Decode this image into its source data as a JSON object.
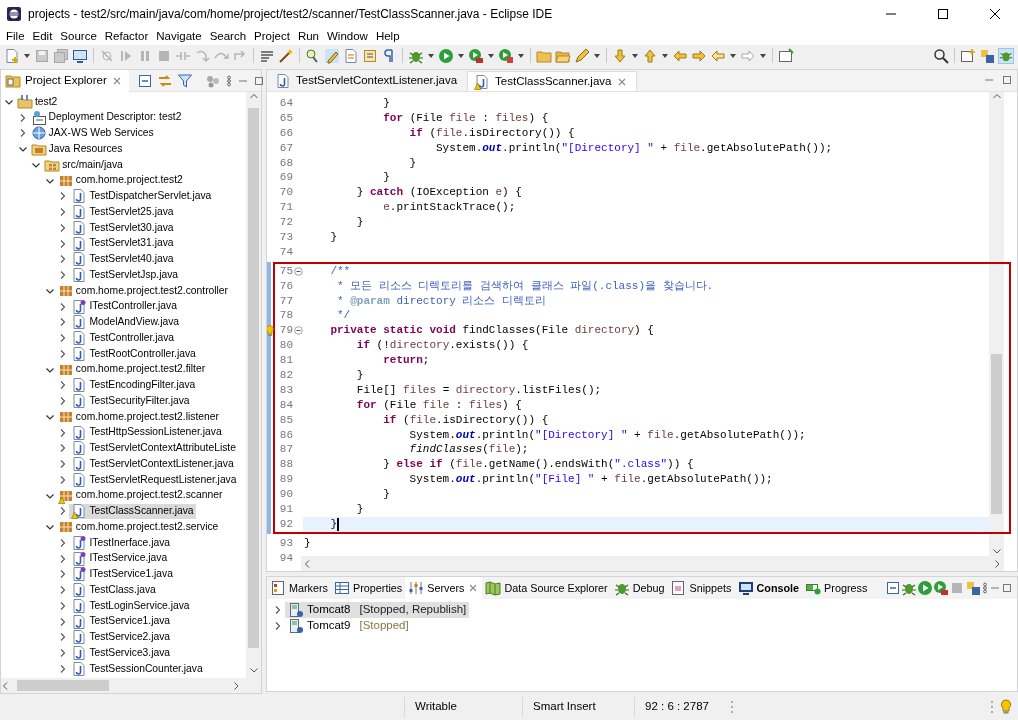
{
  "window": {
    "title": "projects - test2/src/main/java/com/home/project/test2/scanner/TestClassScanner.java - Eclipse IDE"
  },
  "menu": [
    "File",
    "Edit",
    "Source",
    "Refactor",
    "Navigate",
    "Search",
    "Project",
    "Run",
    "Window",
    "Help"
  ],
  "project_explorer": {
    "title": "Project Explorer",
    "tree": [
      {
        "label": "test2",
        "kind": "project",
        "expanded": true,
        "selected": false,
        "warning": false,
        "children": [
          {
            "label": "Deployment Descriptor: test2",
            "kind": "descriptor",
            "expanded": false,
            "selected": false,
            "warning": false
          },
          {
            "label": "JAX-WS Web Services",
            "kind": "webservices",
            "expanded": false,
            "selected": false,
            "warning": false
          },
          {
            "label": "Java Resources",
            "kind": "resources",
            "expanded": true,
            "selected": false,
            "warning": false,
            "children": [
              {
                "label": "src/main/java",
                "kind": "srcfolder",
                "expanded": true,
                "selected": false,
                "warning": false,
                "children": [
                  {
                    "label": "com.home.project.test2",
                    "kind": "package",
                    "expanded": true,
                    "selected": false,
                    "warning": false,
                    "children": [
                      {
                        "label": "TestDispatcherServlet.java",
                        "kind": "class",
                        "expanded": false,
                        "selected": false,
                        "warning": false
                      },
                      {
                        "label": "TestServlet25.java",
                        "kind": "class",
                        "expanded": false,
                        "selected": false,
                        "warning": false
                      },
                      {
                        "label": "TestServlet30.java",
                        "kind": "class",
                        "expanded": false,
                        "selected": false,
                        "warning": false
                      },
                      {
                        "label": "TestServlet31.java",
                        "kind": "class",
                        "expanded": false,
                        "selected": false,
                        "warning": false
                      },
                      {
                        "label": "TestServlet40.java",
                        "kind": "class",
                        "expanded": false,
                        "selected": false,
                        "warning": false
                      },
                      {
                        "label": "TestServletJsp.java",
                        "kind": "class",
                        "expanded": false,
                        "selected": false,
                        "warning": false
                      }
                    ]
                  },
                  {
                    "label": "com.home.project.test2.controller",
                    "kind": "package",
                    "expanded": true,
                    "selected": false,
                    "warning": false,
                    "children": [
                      {
                        "label": "ITestController.java",
                        "kind": "interface",
                        "expanded": false,
                        "selected": false,
                        "warning": false
                      },
                      {
                        "label": "ModelAndView.java",
                        "kind": "class",
                        "expanded": false,
                        "selected": false,
                        "warning": false
                      },
                      {
                        "label": "TestController.java",
                        "kind": "class",
                        "expanded": false,
                        "selected": false,
                        "warning": false
                      },
                      {
                        "label": "TestRootController.java",
                        "kind": "class",
                        "expanded": false,
                        "selected": false,
                        "warning": false
                      }
                    ]
                  },
                  {
                    "label": "com.home.project.test2.filter",
                    "kind": "package",
                    "expanded": true,
                    "selected": false,
                    "warning": false,
                    "children": [
                      {
                        "label": "TestEncodingFilter.java",
                        "kind": "class",
                        "expanded": false,
                        "selected": false,
                        "warning": false
                      },
                      {
                        "label": "TestSecurityFilter.java",
                        "kind": "class",
                        "expanded": false,
                        "selected": false,
                        "warning": false
                      }
                    ]
                  },
                  {
                    "label": "com.home.project.test2.listener",
                    "kind": "package",
                    "expanded": true,
                    "selected": false,
                    "warning": false,
                    "children": [
                      {
                        "label": "TestHttpSessionListener.java",
                        "kind": "class",
                        "expanded": false,
                        "selected": false,
                        "warning": false
                      },
                      {
                        "label": "TestServletContextAttributeListe",
                        "kind": "class",
                        "expanded": false,
                        "selected": false,
                        "warning": false
                      },
                      {
                        "label": "TestServletContextListener.java",
                        "kind": "class",
                        "expanded": false,
                        "selected": false,
                        "warning": false
                      },
                      {
                        "label": "TestServletRequestListener.java",
                        "kind": "class",
                        "expanded": false,
                        "selected": false,
                        "warning": false
                      }
                    ]
                  },
                  {
                    "label": "com.home.project.test2.scanner",
                    "kind": "package",
                    "expanded": true,
                    "selected": false,
                    "warning": true,
                    "children": [
                      {
                        "label": "TestClassScanner.java",
                        "kind": "class",
                        "expanded": false,
                        "selected": true,
                        "warning": true
                      }
                    ]
                  },
                  {
                    "label": "com.home.project.test2.service",
                    "kind": "package",
                    "expanded": true,
                    "selected": false,
                    "warning": false,
                    "children": [
                      {
                        "label": "ITestInerface.java",
                        "kind": "interface",
                        "expanded": false,
                        "selected": false,
                        "warning": false
                      },
                      {
                        "label": "ITestService.java",
                        "kind": "interface",
                        "expanded": false,
                        "selected": false,
                        "warning": false
                      },
                      {
                        "label": "ITestService1.java",
                        "kind": "interface",
                        "expanded": false,
                        "selected": false,
                        "warning": false
                      },
                      {
                        "label": "TestClass.java",
                        "kind": "class",
                        "expanded": false,
                        "selected": false,
                        "warning": false
                      },
                      {
                        "label": "TestLoginService.java",
                        "kind": "class",
                        "expanded": false,
                        "selected": false,
                        "warning": false
                      },
                      {
                        "label": "TestService1.java",
                        "kind": "class",
                        "expanded": false,
                        "selected": false,
                        "warning": false
                      },
                      {
                        "label": "TestService2.java",
                        "kind": "class",
                        "expanded": false,
                        "selected": false,
                        "warning": false
                      },
                      {
                        "label": "TestService3.java",
                        "kind": "class",
                        "expanded": false,
                        "selected": false,
                        "warning": false
                      },
                      {
                        "label": "TestSessionCounter.java",
                        "kind": "class",
                        "expanded": false,
                        "selected": false,
                        "warning": false
                      }
                    ]
                  }
                ]
              }
            ]
          }
        ]
      }
    ]
  },
  "editor": {
    "tabs": [
      {
        "label": "TestServletContextListener.java",
        "selected": false,
        "warning": false
      },
      {
        "label": "TestClassScanner.java",
        "selected": true,
        "warning": true
      }
    ],
    "blocks": [
      {
        "highlighted": false,
        "changed": false,
        "lines": [
          {
            "number": "64",
            "current": false,
            "fold": false,
            "warning": false,
            "tokens": [
              {
                "kind": "plain",
                "text": "            }"
              }
            ]
          },
          {
            "number": "65",
            "current": false,
            "fold": false,
            "warning": false,
            "tokens": [
              {
                "kind": "keyword",
                "text": "            for"
              },
              {
                "kind": "plain",
                "text": " (File "
              },
              {
                "kind": "variable",
                "text": "file"
              },
              {
                "kind": "plain",
                "text": " : "
              },
              {
                "kind": "variable",
                "text": "files"
              },
              {
                "kind": "plain",
                "text": ") {"
              }
            ]
          },
          {
            "number": "66",
            "current": false,
            "fold": false,
            "warning": false,
            "tokens": [
              {
                "kind": "keyword",
                "text": "                if"
              },
              {
                "kind": "plain",
                "text": " ("
              },
              {
                "kind": "variable",
                "text": "file"
              },
              {
                "kind": "plain",
                "text": ".isDirectory()) {"
              }
            ]
          },
          {
            "number": "67",
            "current": false,
            "fold": false,
            "warning": false,
            "tokens": [
              {
                "kind": "plain",
                "text": "                    System."
              },
              {
                "kind": "field",
                "text": "out"
              },
              {
                "kind": "plain",
                "text": ".println("
              },
              {
                "kind": "string",
                "text": "\"[Directory] \""
              },
              {
                "kind": "plain",
                "text": " + "
              },
              {
                "kind": "variable",
                "text": "file"
              },
              {
                "kind": "plain",
                "text": ".getAbsolutePath());"
              }
            ]
          },
          {
            "number": "68",
            "current": false,
            "fold": false,
            "warning": false,
            "tokens": [
              {
                "kind": "plain",
                "text": "                }"
              }
            ]
          },
          {
            "number": "69",
            "current": false,
            "fold": false,
            "warning": false,
            "tokens": [
              {
                "kind": "plain",
                "text": "            }"
              }
            ]
          },
          {
            "number": "70",
            "current": false,
            "fold": false,
            "warning": false,
            "tokens": [
              {
                "kind": "plain",
                "text": "        } "
              },
              {
                "kind": "keyword",
                "text": "catch"
              },
              {
                "kind": "plain",
                "text": " (IOException "
              },
              {
                "kind": "variable",
                "text": "e"
              },
              {
                "kind": "plain",
                "text": ") {"
              }
            ]
          },
          {
            "number": "71",
            "current": false,
            "fold": false,
            "warning": false,
            "tokens": [
              {
                "kind": "variable",
                "text": "            e"
              },
              {
                "kind": "plain",
                "text": ".printStackTrace();"
              }
            ]
          },
          {
            "number": "72",
            "current": false,
            "fold": false,
            "warning": false,
            "tokens": [
              {
                "kind": "plain",
                "text": "        }"
              }
            ]
          },
          {
            "number": "73",
            "current": false,
            "fold": false,
            "warning": false,
            "tokens": [
              {
                "kind": "plain",
                "text": "    }"
              }
            ]
          },
          {
            "number": "74",
            "current": false,
            "fold": false,
            "warning": false
          }
        ]
      },
      {
        "highlighted": true,
        "changed": true,
        "lines": [
          {
            "number": "75",
            "current": false,
            "fold": true,
            "warning": false,
            "tokens": [
              {
                "kind": "comment",
                "text": "    /**"
              }
            ]
          },
          {
            "number": "76",
            "current": false,
            "fold": false,
            "warning": false,
            "tokens": [
              {
                "kind": "comment",
                "text": "     * 모든 리소스 디렉토리를 검색하여 클래스 파일(.class)을 찾습니다."
              }
            ]
          },
          {
            "number": "77",
            "current": false,
            "fold": false,
            "warning": false,
            "tokens": [
              {
                "kind": "comment",
                "text": "     * "
              },
              {
                "kind": "tag",
                "text": "@param"
              },
              {
                "kind": "comment",
                "text": " directory 리소스 디렉토리"
              }
            ]
          },
          {
            "number": "78",
            "current": false,
            "fold": false,
            "warning": false,
            "tokens": [
              {
                "kind": "comment",
                "text": "     */"
              }
            ]
          },
          {
            "number": "79",
            "current": false,
            "fold": true,
            "warning": true,
            "tokens": [
              {
                "kind": "keyword",
                "text": "    private "
              },
              {
                "kind": "keyword",
                "text": "static "
              },
              {
                "kind": "keyword",
                "text": "void"
              },
              {
                "kind": "plain",
                "text": " findClasses(File "
              },
              {
                "kind": "variable",
                "text": "directory"
              },
              {
                "kind": "plain",
                "text": ") {"
              }
            ]
          },
          {
            "number": "80",
            "current": false,
            "fold": false,
            "warning": false,
            "tokens": [
              {
                "kind": "keyword",
                "text": "        if"
              },
              {
                "kind": "plain",
                "text": " (!"
              },
              {
                "kind": "variable",
                "text": "directory"
              },
              {
                "kind": "plain",
                "text": ".exists()) {"
              }
            ]
          },
          {
            "number": "81",
            "current": false,
            "fold": false,
            "warning": false,
            "tokens": [
              {
                "kind": "keyword",
                "text": "            return"
              },
              {
                "kind": "plain",
                "text": ";"
              }
            ]
          },
          {
            "number": "82",
            "current": false,
            "fold": false,
            "warning": false,
            "tokens": [
              {
                "kind": "plain",
                "text": "        }"
              }
            ]
          },
          {
            "number": "83",
            "current": false,
            "fold": false,
            "warning": false,
            "tokens": [
              {
                "kind": "plain",
                "text": "        File[] "
              },
              {
                "kind": "variable",
                "text": "files"
              },
              {
                "kind": "plain",
                "text": " = "
              },
              {
                "kind": "variable",
                "text": "directory"
              },
              {
                "kind": "plain",
                "text": ".listFiles();"
              }
            ]
          },
          {
            "number": "84",
            "current": false,
            "fold": false,
            "warning": false,
            "tokens": [
              {
                "kind": "keyword",
                "text": "        for"
              },
              {
                "kind": "plain",
                "text": " (File "
              },
              {
                "kind": "variable",
                "text": "file"
              },
              {
                "kind": "plain",
                "text": " : "
              },
              {
                "kind": "variable",
                "text": "files"
              },
              {
                "kind": "plain",
                "text": ") {"
              }
            ]
          },
          {
            "number": "85",
            "current": false,
            "fold": false,
            "warning": false,
            "tokens": [
              {
                "kind": "keyword",
                "text": "            if"
              },
              {
                "kind": "plain",
                "text": " ("
              },
              {
                "kind": "variable",
                "text": "file"
              },
              {
                "kind": "plain",
                "text": ".isDirectory()) {"
              }
            ]
          },
          {
            "number": "86",
            "current": false,
            "fold": false,
            "warning": false,
            "tokens": [
              {
                "kind": "plain",
                "text": "                System."
              },
              {
                "kind": "field",
                "text": "out"
              },
              {
                "kind": "plain",
                "text": ".println("
              },
              {
                "kind": "string",
                "text": "\"[Directory] \""
              },
              {
                "kind": "plain",
                "text": " + "
              },
              {
                "kind": "variable",
                "text": "file"
              },
              {
                "kind": "plain",
                "text": ".getAbsolutePath());"
              }
            ]
          },
          {
            "number": "87",
            "current": false,
            "fold": false,
            "warning": false,
            "tokens": [
              {
                "kind": "static",
                "text": "                findClasses"
              },
              {
                "kind": "plain",
                "text": "("
              },
              {
                "kind": "variable",
                "text": "file"
              },
              {
                "kind": "plain",
                "text": ");"
              }
            ]
          },
          {
            "number": "88",
            "current": false,
            "fold": false,
            "warning": false,
            "tokens": [
              {
                "kind": "plain",
                "text": "            } "
              },
              {
                "kind": "keyword",
                "text": "else "
              },
              {
                "kind": "keyword",
                "text": "if"
              },
              {
                "kind": "plain",
                "text": " ("
              },
              {
                "kind": "variable",
                "text": "file"
              },
              {
                "kind": "plain",
                "text": ".getName().endsWith("
              },
              {
                "kind": "string",
                "text": "\".class\""
              },
              {
                "kind": "plain",
                "text": ")) {"
              }
            ]
          },
          {
            "number": "89",
            "current": false,
            "fold": false,
            "warning": false,
            "tokens": [
              {
                "kind": "plain",
                "text": "                System."
              },
              {
                "kind": "field",
                "text": "out"
              },
              {
                "kind": "plain",
                "text": ".println("
              },
              {
                "kind": "string",
                "text": "\"[File] \""
              },
              {
                "kind": "plain",
                "text": " + "
              },
              {
                "kind": "variable",
                "text": "file"
              },
              {
                "kind": "plain",
                "text": ".getAbsolutePath());"
              }
            ]
          },
          {
            "number": "90",
            "current": false,
            "fold": false,
            "warning": false,
            "tokens": [
              {
                "kind": "plain",
                "text": "            }"
              }
            ]
          },
          {
            "number": "91",
            "current": false,
            "fold": false,
            "warning": false,
            "tokens": [
              {
                "kind": "plain",
                "text": "        }"
              }
            ]
          },
          {
            "number": "92",
            "current": true,
            "fold": false,
            "warning": false,
            "tokens": [
              {
                "kind": "plain",
                "text": "    }"
              }
            ]
          }
        ]
      },
      {
        "highlighted": false,
        "changed": false,
        "lines": [
          {
            "number": "93",
            "current": false,
            "fold": false,
            "warning": false,
            "tokens": [
              {
                "kind": "plain",
                "text": "}"
              }
            ]
          },
          {
            "number": "94",
            "current": false,
            "fold": false,
            "warning": false
          }
        ]
      }
    ]
  },
  "bottom_panel": {
    "tabs": [
      {
        "label": "Markers",
        "kind": "markers",
        "selected": false,
        "attention": false
      },
      {
        "label": "Properties",
        "kind": "properties",
        "selected": false,
        "attention": false
      },
      {
        "label": "Servers",
        "kind": "servers",
        "selected": true,
        "attention": false
      },
      {
        "label": "Data Source Explorer",
        "kind": "datasource",
        "selected": false,
        "attention": false
      },
      {
        "label": "Debug",
        "kind": "debug",
        "selected": false,
        "attention": false
      },
      {
        "label": "Snippets",
        "kind": "snippets",
        "selected": false,
        "attention": false
      },
      {
        "label": "Console",
        "kind": "console",
        "selected": false,
        "attention": true
      },
      {
        "label": "Progress",
        "kind": "progress",
        "selected": false,
        "attention": false
      }
    ],
    "servers": [
      {
        "name": "Tomcat8",
        "status": "[Stopped, Republish]",
        "selected": true
      },
      {
        "name": "Tomcat9",
        "status": "[Stopped]",
        "selected": false
      }
    ]
  },
  "status_bar": [
    "Writable",
    "Smart Insert",
    "92 : 6 : 2787"
  ]
}
